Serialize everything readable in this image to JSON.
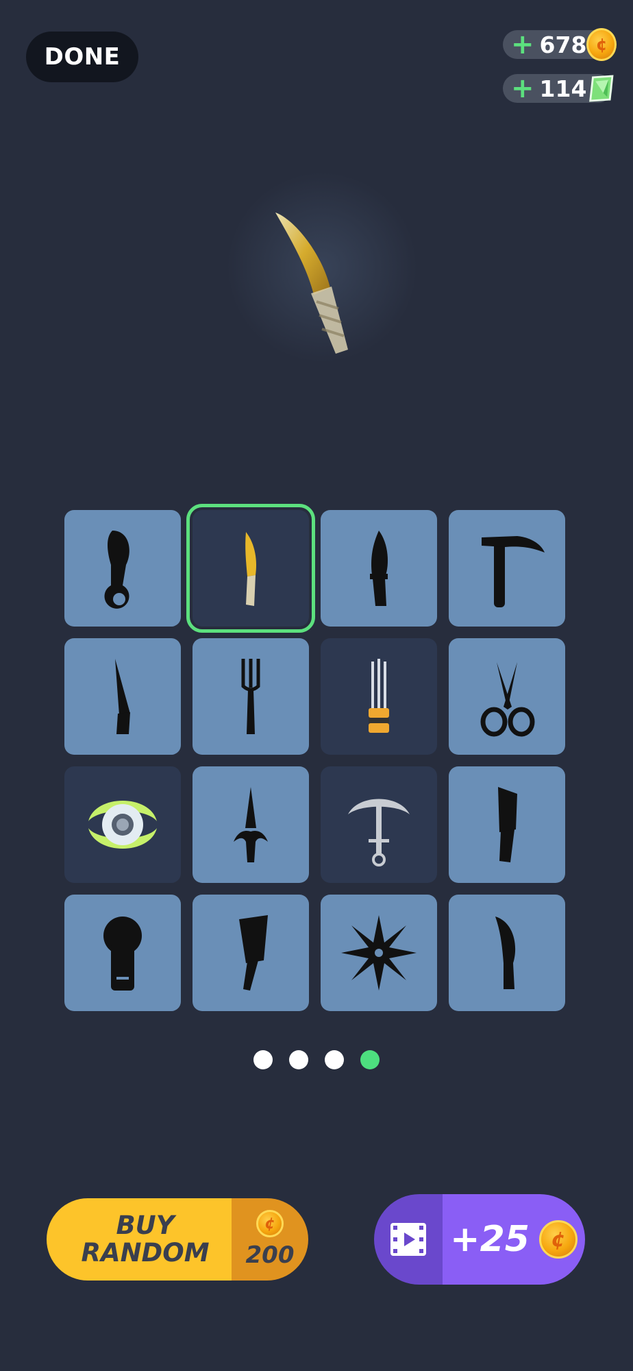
{
  "header": {
    "done_label": "DONE",
    "coins": {
      "plus": "+",
      "value": "678",
      "icon": "coin-icon"
    },
    "gems": {
      "plus": "+",
      "value": "114",
      "icon": "gem-icon"
    }
  },
  "preview": {
    "icon": "golden-knife-icon"
  },
  "grid": {
    "tiles": [
      {
        "icon": "karambit-knife-icon",
        "state": "locked"
      },
      {
        "icon": "golden-knife-icon",
        "state": "selected"
      },
      {
        "icon": "bowie-knife-icon",
        "state": "locked"
      },
      {
        "icon": "scythe-icon",
        "state": "locked"
      },
      {
        "icon": "saw-knife-icon",
        "state": "locked"
      },
      {
        "icon": "fork-icon",
        "state": "locked"
      },
      {
        "icon": "claws-icon",
        "state": "owned"
      },
      {
        "icon": "scissors-icon",
        "state": "locked"
      },
      {
        "icon": "spinner-blade-icon",
        "state": "owned"
      },
      {
        "icon": "sai-dagger-icon",
        "state": "locked"
      },
      {
        "icon": "anchor-icon",
        "state": "owned"
      },
      {
        "icon": "machete-icon",
        "state": "locked"
      },
      {
        "icon": "bottle-opener-icon",
        "state": "locked"
      },
      {
        "icon": "cleaver-icon",
        "state": "locked"
      },
      {
        "icon": "shuriken-icon",
        "state": "locked"
      },
      {
        "icon": "hunting-knife-icon",
        "state": "locked"
      }
    ]
  },
  "pagination": {
    "pages": 4,
    "active": 4
  },
  "buy_random": {
    "line1": "BUY",
    "line2": "RANDOM",
    "price": "200"
  },
  "watch_ad": {
    "reward": "+25"
  },
  "colors": {
    "accent_green": "#5ce07e",
    "buy_yellow": "#fdc42a",
    "buy_orange": "#e0931f",
    "ad_purple": "#8a5ef5"
  }
}
